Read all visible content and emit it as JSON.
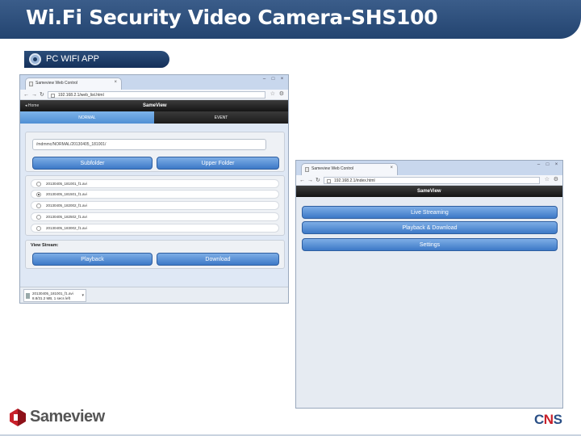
{
  "slide": {
    "title": "Wi.Fi Security Video Camera-SHS100",
    "section_label": "PC WIFI APP"
  },
  "browser_left": {
    "tab_title": "Sameview Web Control",
    "url": "192.168.2.1/web_list.html",
    "home_label": "Home",
    "brand": "SameView",
    "tab_normal": "NORMAL",
    "tab_event": "EVENT",
    "path": "/mdmmc/NORMAL/20130405_181001/",
    "subfolder_button": "Subfolder",
    "upper_folder_button": "Upper Folder",
    "files": [
      "20130405_181001_f1.avi",
      "20130405_181501_f1.avi",
      "20130405_182002_f1.avi",
      "20130405_182502_f1.avi",
      "20130405_183002_f1.avi"
    ],
    "view_stream_label": "View Stream:",
    "playback_button": "Playback",
    "download_button": "Download",
    "download_file": "20130405_181001_f1.avi",
    "download_status": "8.8/31.2 MB, 1 secs left"
  },
  "browser_right": {
    "tab_title": "Sameview Web Control",
    "url": "192.168.2.1/index.html",
    "brand": "SameView",
    "buttons": [
      "Live Streaming",
      "Playback & Download",
      "Settings"
    ]
  },
  "footer": {
    "logo": "Sameview",
    "company_c": "C",
    "company_n": "N",
    "company_s": "S"
  },
  "colors": {
    "header_blue": "#2e5080",
    "button_blue": "#4a86d4",
    "tab_active": "#5a9ad8"
  }
}
